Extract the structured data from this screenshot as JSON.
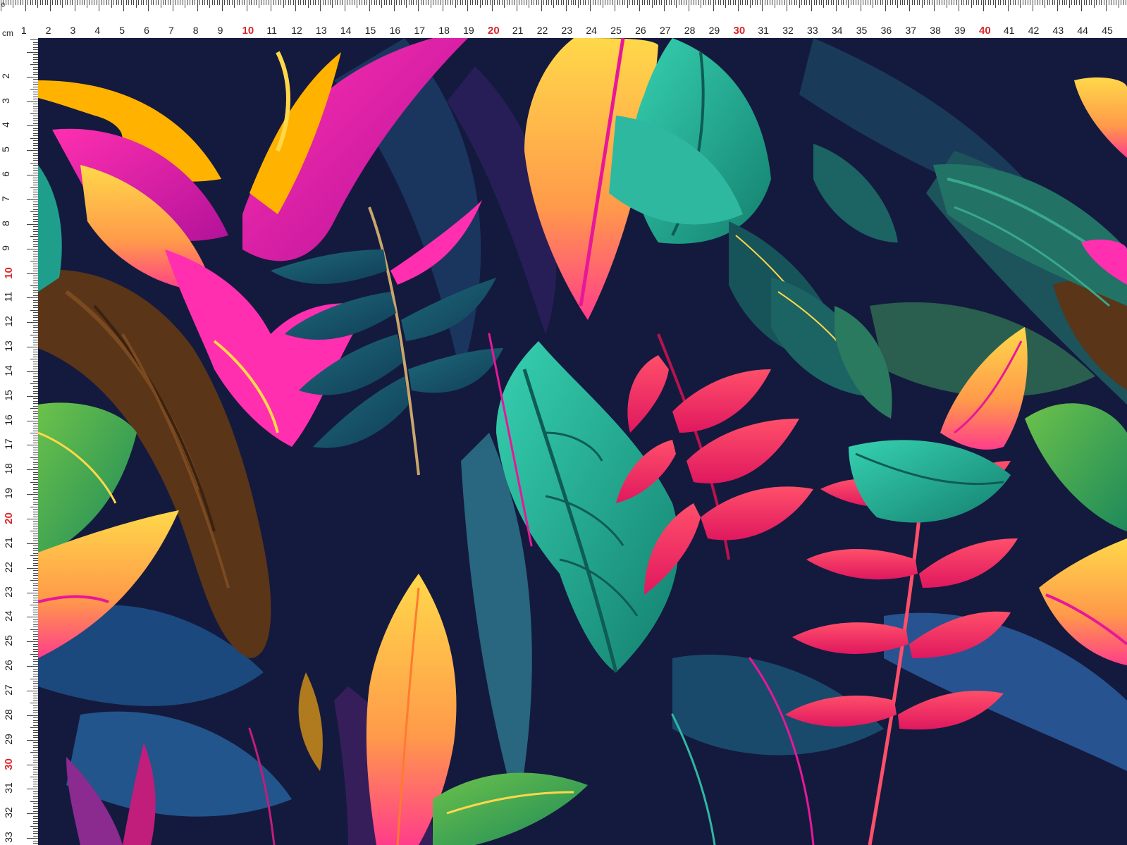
{
  "ruler": {
    "unit": "cm",
    "corner": "0",
    "top_labels": [
      "1",
      "2",
      "3",
      "4",
      "5",
      "6",
      "7",
      "8",
      "9",
      "10",
      "11",
      "12",
      "13",
      "14",
      "15",
      "16",
      "17",
      "18",
      "19",
      "20",
      "21",
      "22",
      "23",
      "24",
      "25",
      "26",
      "27",
      "28",
      "29",
      "30",
      "31",
      "32",
      "33",
      "34",
      "35",
      "36",
      "37",
      "38",
      "39",
      "40",
      "41",
      "42",
      "43",
      "44",
      "45"
    ],
    "left_labels": [
      "2",
      "3",
      "4",
      "5",
      "6",
      "7",
      "8",
      "9",
      "10",
      "11",
      "12",
      "13",
      "14",
      "15",
      "16",
      "17",
      "18",
      "19",
      "20",
      "21",
      "22",
      "23",
      "24",
      "25",
      "26",
      "27",
      "28",
      "29",
      "30",
      "31",
      "32",
      "33"
    ],
    "highlight_labels": [
      "10",
      "20",
      "30",
      "40"
    ],
    "highlight_color": "#d8262b"
  },
  "fabric": {
    "pattern": "neon tropical jungle leaves",
    "background_color": "#141a3e",
    "palette": [
      "#1f9e8c",
      "#2fb8a0",
      "#1c5f73",
      "#e8179a",
      "#ff3d6e",
      "#ffb300",
      "#ffd84a",
      "#5a3518",
      "#3f7fb0",
      "#5ea13b"
    ]
  }
}
